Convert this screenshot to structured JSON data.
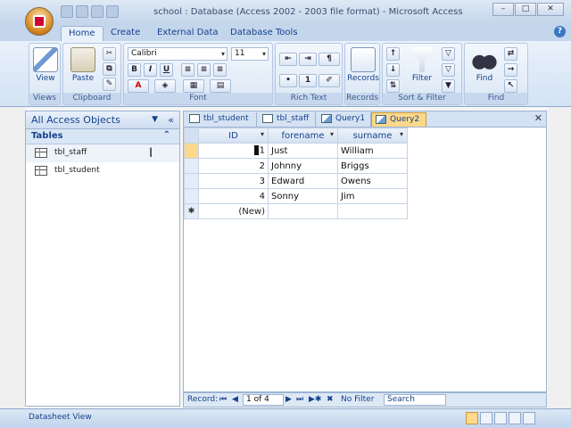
{
  "window": {
    "title": "school : Database (Access 2002 - 2003 file format) - Microsoft Access",
    "min_label": "–",
    "max_label": "□",
    "close_label": "✕"
  },
  "ribbon": {
    "tabs": [
      {
        "label": "Home"
      },
      {
        "label": "Create"
      },
      {
        "label": "External Data"
      },
      {
        "label": "Database Tools"
      }
    ],
    "help_label": "?",
    "groups": {
      "views": {
        "label": "Views",
        "view_button": "View"
      },
      "clipboard": {
        "label": "Clipboard",
        "paste_button": "Paste"
      },
      "font": {
        "label": "Font",
        "font_name": "Calibri",
        "font_size": "11",
        "bold": "B",
        "italic": "I",
        "underline": "U"
      },
      "rich_text": {
        "label": "Rich Text"
      },
      "records": {
        "label": "Records",
        "records_button": "Records"
      },
      "sort_filter": {
        "label": "Sort & Filter",
        "filter_button": "Filter"
      },
      "find": {
        "label": "Find",
        "find_button": "Find"
      }
    }
  },
  "nav_pane": {
    "header": "All Access Objects",
    "group": "Tables",
    "items": [
      {
        "label": "tbl_staff"
      },
      {
        "label": "tbl_student"
      }
    ]
  },
  "doc_tabs": [
    {
      "label": "tbl_student"
    },
    {
      "label": "tbl_staff"
    },
    {
      "label": "Query1"
    },
    {
      "label": "Query2"
    }
  ],
  "datasheet": {
    "columns": [
      "ID",
      "forename",
      "surname"
    ],
    "rows": [
      {
        "id": "1",
        "forename": "Just",
        "surname": "William"
      },
      {
        "id": "2",
        "forename": "Johnny",
        "surname": "Briggs"
      },
      {
        "id": "3",
        "forename": "Edward",
        "surname": "Owens"
      },
      {
        "id": "4",
        "forename": "Sonny",
        "surname": "Jim"
      }
    ],
    "new_row_label": "(New)",
    "new_row_marker": "✱"
  },
  "record_nav": {
    "label": "Record:",
    "first": "⏮",
    "prev": "◀",
    "position": "1 of 4",
    "next": "▶",
    "last": "⏭",
    "new": "▶✱",
    "filter_status": "No Filter",
    "search_placeholder": "Search"
  },
  "status_bar": {
    "text": "Datasheet View"
  }
}
